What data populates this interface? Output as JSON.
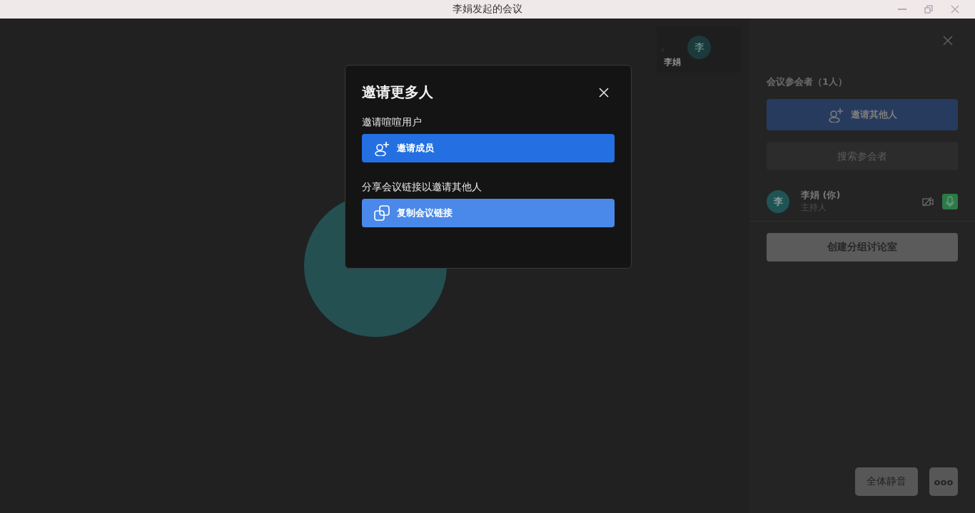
{
  "window": {
    "title": "李娟发起的会议"
  },
  "stage": {
    "thumbnail": {
      "avatar_letter": "李",
      "name": "李娟"
    }
  },
  "dialog": {
    "title": "邀请更多人",
    "sections": [
      {
        "label": "邀请喧喧用户",
        "button": "邀请成员"
      },
      {
        "label": "分享会议链接以邀请其他人",
        "button": "复制会议链接"
      }
    ]
  },
  "panel": {
    "heading": "会议参会者（1人）",
    "invite_button": "邀请其他人",
    "search": {
      "placeholder": "搜索参会者"
    },
    "participants": [
      {
        "avatar_letter": "李",
        "name": "李娟 (你)",
        "role": "主持人",
        "camera_on": false,
        "mic_on": true
      }
    ],
    "breakout_button": "创建分组讨论室",
    "mute_all_button": "全体静音",
    "more_button": "ooo"
  }
}
